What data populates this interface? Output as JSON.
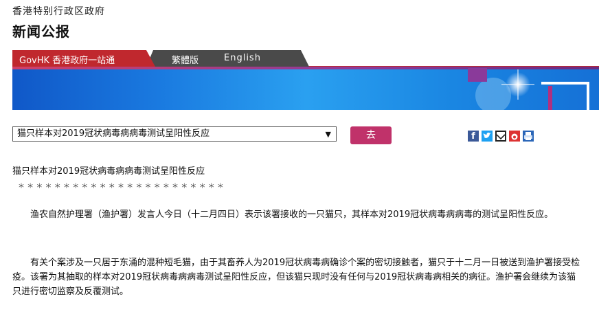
{
  "header": {
    "gov_name": "香港特别行政区政府",
    "section_title": "新闻公报"
  },
  "tabs": [
    {
      "label": "GovHK 香港政府一站通"
    },
    {
      "label": "繁體版"
    },
    {
      "label": "English"
    }
  ],
  "colors": {
    "accent": "#c0326a",
    "tab_red": "#c0282e",
    "tab_dark": "#4a4a4a",
    "banner_blue": "#1a86e2"
  },
  "selector": {
    "value": "猫只样本对2019冠状病毒病病毒测试呈阳性反应",
    "go_label": "去"
  },
  "share_icons": [
    "facebook-icon",
    "twitter-icon",
    "email-icon",
    "weibo-icon",
    "print-icon"
  ],
  "article": {
    "title": "猫只样本对2019冠状病毒病病毒测试呈阳性反应",
    "separator": "＊  ＊  ＊  ＊  ＊  ＊  ＊  ＊  ＊  ＊  ＊  ＊  ＊  ＊  ＊  ＊  ＊  ＊  ＊  ＊  ＊  ＊  ＊",
    "paragraphs": [
      "　　渔农自然护理署（渔护署）发言人今日（十二月四日）表示该署接收的一只猫只，其样本对2019冠状病毒病病毒的测试呈阳性反应。",
      "　　有关个案涉及一只居于东涌的混种短毛猫，由于其畜养人为2019冠状病毒病确诊个案的密切接触者，猫只于十二月一日被送到渔护署接受检疫。该署为其抽取的样本对2019冠状病毒病病毒测试呈阳性反应，但该猫只现时没有任何与2019冠状病毒病相关的病征。渔护署会继续为该猫只进行密切监察及反覆测试。"
    ]
  }
}
